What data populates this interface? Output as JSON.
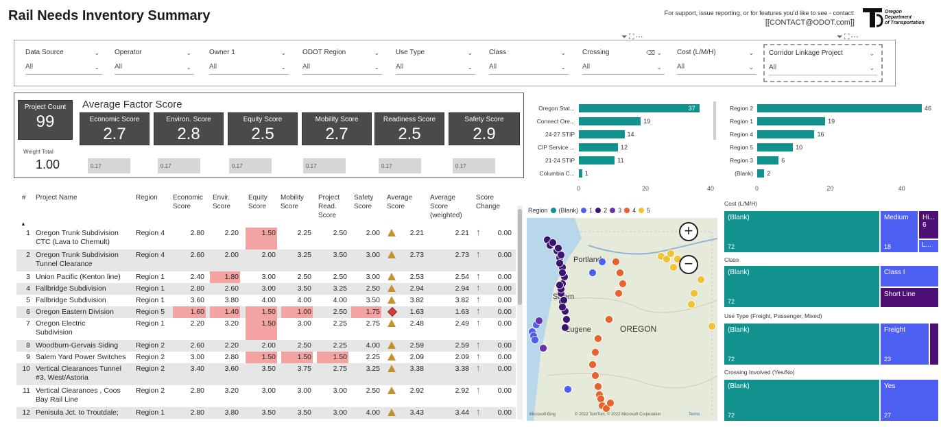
{
  "header": {
    "title": "Rail Needs Inventory Summary",
    "support_line": "For support, issue reporting, or for features you'd like to see - contact:",
    "contact": "[[CONTACT@ODOT.com]]",
    "logo_text": [
      "Oregon",
      "Department",
      "of Transportation"
    ]
  },
  "slicers": [
    {
      "label": "Data Source",
      "value": "All"
    },
    {
      "label": "Operator",
      "value": "All"
    },
    {
      "label": "Owner 1",
      "value": "All"
    },
    {
      "label": "ODOT Region",
      "value": "All"
    },
    {
      "label": "Use Type",
      "value": "All"
    },
    {
      "label": "Class",
      "value": "All"
    },
    {
      "label": "Crossing",
      "value": "All"
    },
    {
      "label": "Cost (L/M/H)",
      "value": "All"
    },
    {
      "label": "Corridor Linkage Project",
      "value": "All"
    }
  ],
  "kpi": {
    "project_count_label": "Project Count",
    "project_count": "99",
    "avg_factor_title": "Average Factor Score",
    "weight_total_label": "Weight Total",
    "weight_total": "1.00",
    "scores": [
      {
        "label": "Economic Score",
        "value": "2.7",
        "weight": "0.17"
      },
      {
        "label": "Environ. Score",
        "value": "2.8",
        "weight": "0.17"
      },
      {
        "label": "Equity Score",
        "value": "2.5",
        "weight": "0.17"
      },
      {
        "label": "Mobility Score",
        "value": "2.7",
        "weight": "0.17"
      },
      {
        "label": "Readiness Score",
        "value": "2.5",
        "weight": "0.17"
      },
      {
        "label": "Safety Score",
        "value": "2.9",
        "weight": "0.17"
      }
    ]
  },
  "table": {
    "headers": [
      "#",
      "Project Name",
      "Region",
      "Economic Score",
      "Envir. Score",
      "Equity Score",
      "Mobility Score",
      "Project Read. Score",
      "Safety Score",
      "Average Score",
      "Average Score (weighted)",
      "Score Change"
    ],
    "rows": [
      {
        "n": "1",
        "name": [
          "Oregon Trunk Subdivision",
          "CTC (Lava to Chemult)"
        ],
        "region": "Region 4",
        "econ": "2.80",
        "env": "2.20",
        "eq": "1.50",
        "mob": "2.25",
        "read": "2.50",
        "safe": "2.00",
        "ind": "tri",
        "avg": "2.21",
        "avgw": "2.21",
        "chg": "0.00",
        "hl": [
          "eq"
        ]
      },
      {
        "n": "2",
        "name": [
          "Oregon Trunk Subdivision",
          "Tunnel Clearance"
        ],
        "region": "Region 4",
        "econ": "2.60",
        "env": "2.00",
        "eq": "2.00",
        "mob": "3.25",
        "read": "3.50",
        "safe": "3.00",
        "ind": "tri",
        "avg": "2.73",
        "avgw": "2.73",
        "chg": "0.00",
        "hl": []
      },
      {
        "n": "3",
        "name": [
          "Union Pacific (Kenton line)"
        ],
        "region": "Region 1",
        "econ": "2.40",
        "env": "1.80",
        "eq": "3.00",
        "mob": "2.50",
        "read": "2.50",
        "safe": "3.00",
        "ind": "tri",
        "avg": "2.53",
        "avgw": "2.54",
        "chg": "0.00",
        "hl": [
          "env"
        ]
      },
      {
        "n": "4",
        "name": [
          "Fallbridge Subdivision"
        ],
        "region": "Region 1",
        "econ": "2.80",
        "env": "2.60",
        "eq": "3.00",
        "mob": "3.50",
        "read": "3.25",
        "safe": "2.50",
        "ind": "tri",
        "avg": "2.94",
        "avgw": "2.94",
        "chg": "0.00",
        "hl": []
      },
      {
        "n": "5",
        "name": [
          "Fallbridge Subdivision"
        ],
        "region": "Region 1",
        "econ": "3.60",
        "env": "3.80",
        "eq": "4.00",
        "mob": "4.00",
        "read": "4.00",
        "safe": "3.50",
        "ind": "tri",
        "avg": "3.82",
        "avgw": "3.82",
        "chg": "0.00",
        "hl": []
      },
      {
        "n": "6",
        "name": [
          "Oregon Eastern Division"
        ],
        "region": "Region 5",
        "econ": "1.60",
        "env": "1.40",
        "eq": "1.50",
        "mob": "1.00",
        "read": "2.50",
        "safe": "1.75",
        "ind": "dia",
        "avg": "1.63",
        "avgw": "1.63",
        "chg": "0.00",
        "hl": [
          "econ",
          "env",
          "eq",
          "mob",
          "safe"
        ]
      },
      {
        "n": "7",
        "name": [
          "Oregon Electric",
          "Subdivision"
        ],
        "region": "Region 1",
        "econ": "2.20",
        "env": "3.20",
        "eq": "1.50",
        "mob": "3.00",
        "read": "2.25",
        "safe": "2.75",
        "ind": "tri",
        "avg": "2.48",
        "avgw": "2.49",
        "chg": "0.00",
        "hl": [
          "eq"
        ]
      },
      {
        "n": "8",
        "name": [
          "Woodburn-Gervais Siding"
        ],
        "region": "Region 2",
        "econ": "2.60",
        "env": "2.20",
        "eq": "2.00",
        "mob": "2.50",
        "read": "2.25",
        "safe": "4.00",
        "ind": "tri",
        "avg": "2.59",
        "avgw": "2.59",
        "chg": "0.00",
        "hl": []
      },
      {
        "n": "9",
        "name": [
          "Salem Yard Power Switches"
        ],
        "region": "Region 2",
        "econ": "3.00",
        "env": "2.80",
        "eq": "1.50",
        "mob": "1.50",
        "read": "1.50",
        "safe": "2.25",
        "ind": "tri",
        "avg": "2.09",
        "avgw": "2.09",
        "chg": "0.00",
        "hl": [
          "eq",
          "mob",
          "read"
        ]
      },
      {
        "n": "10",
        "name": [
          "Vertical Clearances Tunnel",
          "#3, West/Astoria"
        ],
        "region": "Region 2",
        "econ": "3.40",
        "env": "3.60",
        "eq": "3.50",
        "mob": "3.75",
        "read": "2.75",
        "safe": "3.25",
        "ind": "tri",
        "avg": "3.38",
        "avgw": "3.38",
        "chg": "0.00",
        "hl": []
      },
      {
        "n": "11",
        "name": [
          "Vertical Clearances , Coos",
          "Bay Rail Line"
        ],
        "region": "Region 2",
        "econ": "2.80",
        "env": "3.20",
        "eq": "3.00",
        "mob": "3.00",
        "read": "3.00",
        "safe": "2.50",
        "ind": "tri",
        "avg": "2.92",
        "avgw": "2.92",
        "chg": "0.00",
        "hl": []
      },
      {
        "n": "12",
        "name": [
          "Penisula Jct. to Troutdale;"
        ],
        "region": "Region 1",
        "econ": "2.80",
        "env": "3.80",
        "eq": "3.50",
        "mob": "3.50",
        "read": "3.00",
        "safe": "4.00",
        "ind": "tri",
        "avg": "3.43",
        "avgw": "3.44",
        "chg": "0.00",
        "hl": []
      }
    ]
  },
  "chart_data": [
    {
      "type": "bar",
      "orientation": "horizontal",
      "categories": [
        "Oregon Stat...",
        "Connect Ore...",
        "24-27 STIP",
        "CIP Service ...",
        "21-24 STIP",
        "Columbia C..."
      ],
      "values": [
        37,
        19,
        14,
        12,
        11,
        1
      ],
      "xticks": [
        "0",
        "20",
        "40"
      ],
      "xlim": [
        0,
        40
      ],
      "color": "#11928f"
    },
    {
      "type": "bar",
      "orientation": "horizontal",
      "categories": [
        "Region 2",
        "Region 1",
        "Region 4",
        "Region 5",
        "Region 3",
        "(Blank)"
      ],
      "values": [
        46,
        19,
        16,
        10,
        6,
        2
      ],
      "xticks": [
        "0",
        "20",
        "40"
      ],
      "xlim": [
        0,
        46
      ],
      "color": "#11928f"
    }
  ],
  "map": {
    "legend_title": "Region",
    "legend": [
      {
        "label": "(Blank)",
        "color": "#11928f"
      },
      {
        "label": "1",
        "color": "#4d5ff0"
      },
      {
        "label": "2",
        "color": "#3b1470"
      },
      {
        "label": "3",
        "color": "#6a30a8"
      },
      {
        "label": "4",
        "color": "#e8622a"
      },
      {
        "label": "5",
        "color": "#f2c233"
      }
    ],
    "labels": {
      "city1": "Portland",
      "city2": "Salem",
      "city3": "Eugene",
      "state": "OREGON"
    },
    "attribution": "© 2022 TomTom, © 2022 Microsoft Corporation",
    "terms": "Terms",
    "brand": "Microsoft Bing"
  },
  "treemaps": [
    {
      "title": "Cost (L/M/H)",
      "tiles": [
        {
          "label": "(Blank)",
          "value": "72",
          "color": "teal"
        },
        {
          "label": "Medium",
          "value": "18",
          "color": "blue"
        },
        {
          "label": "Hi...",
          "value": "6",
          "color": "purple"
        },
        {
          "label": "L...",
          "value": "",
          "color": "blue"
        }
      ]
    },
    {
      "title": "Class",
      "tiles": [
        {
          "label": "(Blank)",
          "value": "72",
          "color": "teal"
        },
        {
          "label": "Class I",
          "value": "",
          "color": "blue"
        },
        {
          "label": "Short Line",
          "value": "",
          "color": "purple"
        }
      ]
    },
    {
      "title": "Use Type (Freight, Passenger, Mixed)",
      "tiles": [
        {
          "label": "(Blank)",
          "value": "72",
          "color": "teal"
        },
        {
          "label": "Freight",
          "value": "23",
          "color": "blue"
        },
        {
          "label": "",
          "value": "",
          "color": "purple"
        }
      ]
    },
    {
      "title": "Crossing Involved (Yes/No)",
      "tiles": [
        {
          "label": "(Blank)",
          "value": "72",
          "color": "teal"
        },
        {
          "label": "Yes",
          "value": "27",
          "color": "blue"
        }
      ]
    }
  ]
}
